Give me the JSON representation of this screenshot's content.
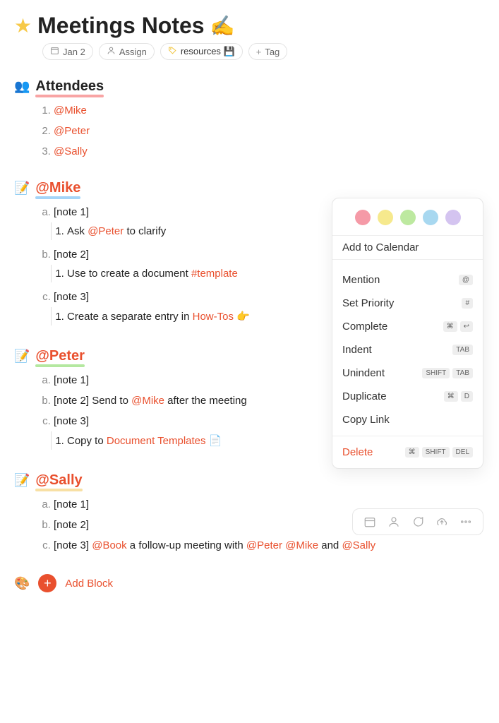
{
  "title": "Meetings Notes",
  "title_emoji": "✍️",
  "meta": {
    "date": "Jan 2",
    "assign": "Assign",
    "tag_resources": "resources 💾",
    "add_tag": "Tag"
  },
  "sections": {
    "attendees": {
      "title": "Attendees",
      "items": [
        "@Mike",
        "@Peter",
        "@Sally"
      ]
    },
    "mike": {
      "title": "@Mike",
      "notes": {
        "a": {
          "label": "[note 1]",
          "sub_pre": "Ask ",
          "sub_mention": "@Peter",
          "sub_post": " to clarify"
        },
        "b": {
          "label": "[note 2]",
          "sub_pre": "Use to create a document ",
          "sub_tag": "#template"
        },
        "c": {
          "label": "[note 3]",
          "sub_pre": "Create a separate entry in ",
          "sub_link": "How-Tos",
          "sub_emoji": "👉"
        }
      }
    },
    "peter": {
      "title": "@Peter",
      "notes": {
        "a": {
          "label": "[note 1]"
        },
        "b": {
          "label_pre": "[note 2] Send to ",
          "label_mention": "@Mike",
          "label_post": " after the meeting"
        },
        "c": {
          "label": "[note 3]",
          "sub_pre": "Copy to ",
          "sub_link": "Document Templates",
          "sub_emoji": "📄"
        }
      }
    },
    "sally": {
      "title": "@Sally",
      "notes": {
        "a": {
          "label": "[note 1]"
        },
        "b": {
          "label": "[note 2]"
        },
        "c": {
          "pre": "[note 3] ",
          "m1": "@Book",
          "mid1": " a follow-up meeting with ",
          "m2": "@Peter",
          "sp1": " ",
          "m3": "@Mike",
          "mid2": " and ",
          "m4": "@Sally"
        }
      }
    }
  },
  "popup": {
    "add_calendar": "Add to Calendar",
    "items": [
      {
        "label": "Mention",
        "keys": [
          "@"
        ]
      },
      {
        "label": "Set Priority",
        "keys": [
          "#"
        ]
      },
      {
        "label": "Complete",
        "keys": [
          "⌘",
          "↩"
        ]
      },
      {
        "label": "Indent",
        "keys": [
          "TAB"
        ]
      },
      {
        "label": "Unindent",
        "keys": [
          "SHIFT",
          "TAB"
        ]
      },
      {
        "label": "Duplicate",
        "keys": [
          "⌘",
          "D"
        ]
      },
      {
        "label": "Copy Link",
        "keys": []
      }
    ],
    "delete": {
      "label": "Delete",
      "keys": [
        "⌘",
        "SHIFT",
        "DEL"
      ]
    },
    "colors": [
      "#f59aa7",
      "#f6e98d",
      "#bde9a0",
      "#a8d8f0",
      "#d4c4f0"
    ]
  },
  "footer": {
    "add_block": "Add Block"
  }
}
